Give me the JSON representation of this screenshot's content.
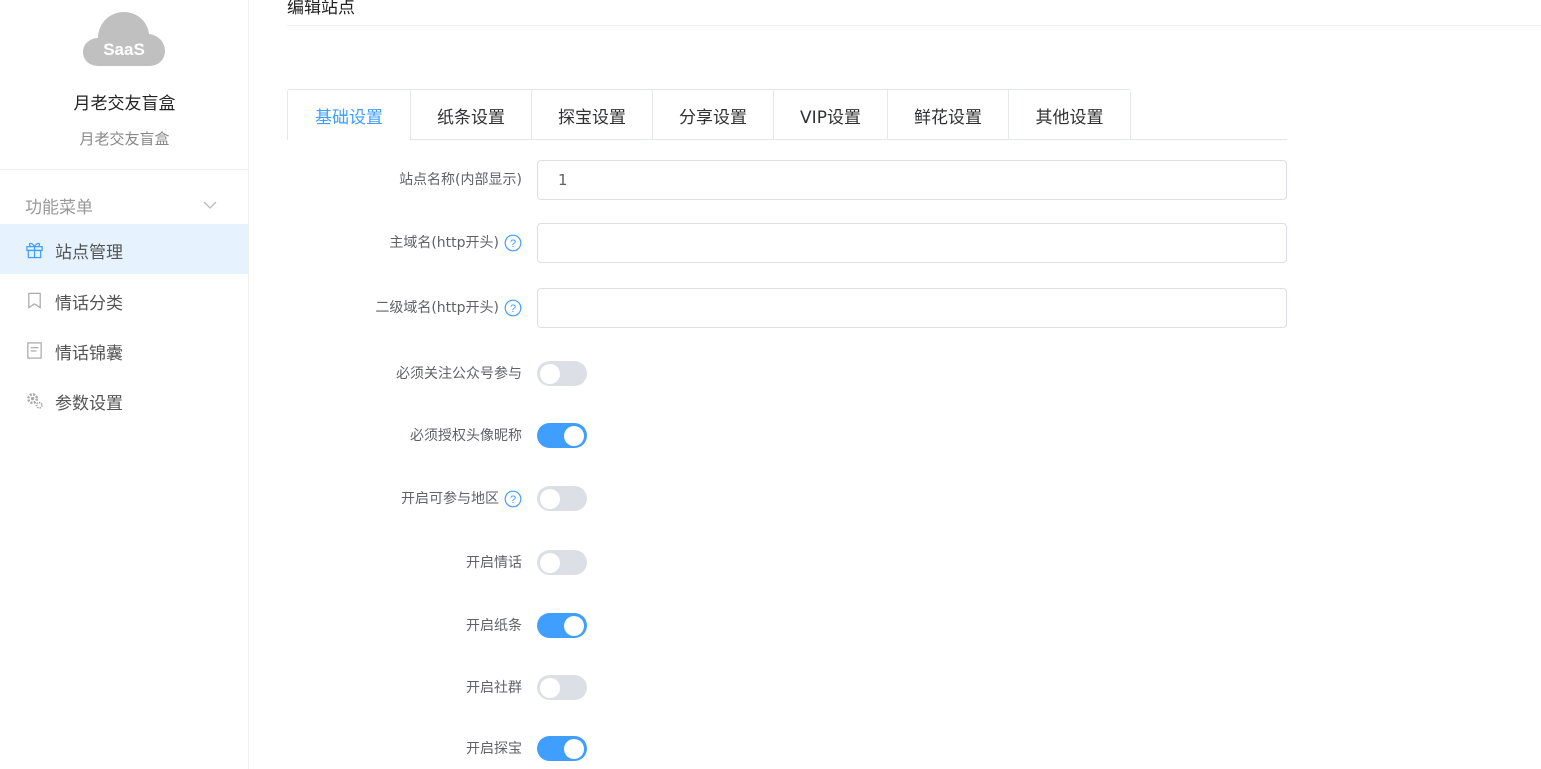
{
  "sidebar": {
    "logo_text": "SaaS",
    "brand_name": "月老交友盲盒",
    "brand_sub": "月老交友盲盒",
    "menu_head": "功能菜单",
    "items": [
      {
        "label": "站点管理",
        "icon": "gift-icon",
        "active": true
      },
      {
        "label": "情话分类",
        "icon": "bookmark-icon",
        "active": false
      },
      {
        "label": "情话锦囊",
        "icon": "document-icon",
        "active": false
      },
      {
        "label": "参数设置",
        "icon": "gear-icon",
        "active": false
      }
    ]
  },
  "page": {
    "title": "编辑站点"
  },
  "tabs": [
    {
      "label": "基础设置",
      "active": true
    },
    {
      "label": "纸条设置",
      "active": false
    },
    {
      "label": "探宝设置",
      "active": false
    },
    {
      "label": "分享设置",
      "active": false
    },
    {
      "label": "VIP设置",
      "active": false
    },
    {
      "label": "鲜花设置",
      "active": false
    },
    {
      "label": "其他设置",
      "active": false
    }
  ],
  "form": {
    "site_name": {
      "label": "站点名称(内部显示)",
      "value": "1"
    },
    "main_domain": {
      "label": "主域名(http开头)",
      "value": ""
    },
    "sub_domain": {
      "label": "二级域名(http开头)",
      "value": ""
    },
    "switches": [
      {
        "label": "必须关注公众号参与",
        "on": false,
        "help": false
      },
      {
        "label": "必须授权头像昵称",
        "on": true,
        "help": false
      },
      {
        "label": "开启可参与地区",
        "on": false,
        "help": true
      },
      {
        "label": "开启情话",
        "on": false,
        "help": false
      },
      {
        "label": "开启纸条",
        "on": true,
        "help": false
      },
      {
        "label": "开启社群",
        "on": false,
        "help": false
      },
      {
        "label": "开启探宝",
        "on": true,
        "help": false
      }
    ]
  },
  "colors": {
    "accent": "#409eff",
    "active_bg": "#e6f2fd",
    "switch_off": "#dcdfe6"
  }
}
